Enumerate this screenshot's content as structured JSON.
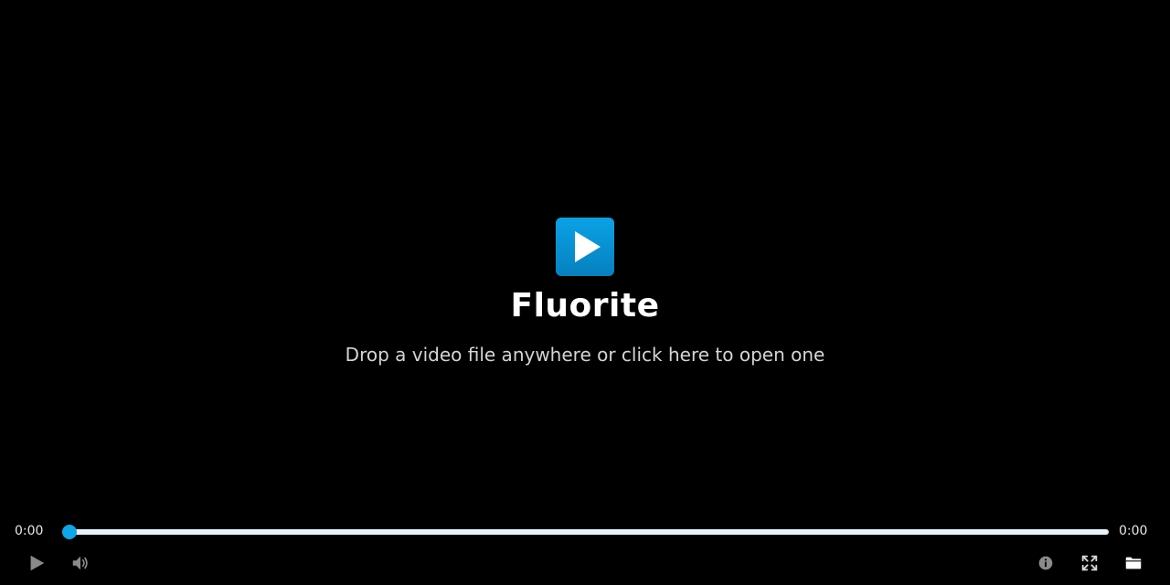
{
  "app": {
    "title": "Fluorite",
    "hint": "Drop a video file anywhere or click here to open one"
  },
  "player": {
    "current_time": "0:00",
    "duration": "0:00",
    "progress": 0
  },
  "icons": {
    "logo": "play-logo-icon",
    "play": "play-icon",
    "volume": "volume-icon",
    "info": "info-icon",
    "fullscreen": "fullscreen-icon",
    "open": "folder-icon"
  },
  "colors": {
    "accent": "#0ea5e9",
    "background": "#000000",
    "track": "#e8f2fb",
    "icon": "#8a8a8a"
  }
}
